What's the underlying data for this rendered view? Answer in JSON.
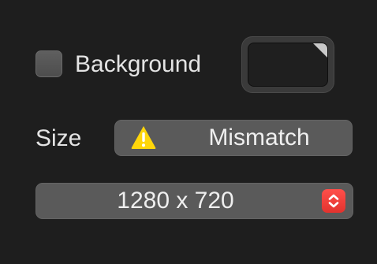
{
  "background": {
    "label": "Background",
    "checked": false,
    "color_well_color": "#1f1f1f"
  },
  "size": {
    "label": "Size",
    "mismatch_label": "Mismatch",
    "warning_icon": "warning-triangle-icon",
    "warning_color": "#ffd60a"
  },
  "resolution": {
    "selected": "1280 x 720",
    "stepper_icon": "chevron-up-down-icon",
    "accent": "#ff453a"
  },
  "theme": {
    "panel_bg": "#1e1e1e",
    "control_bg": "#5a5a5a",
    "text": "#e6e6e6"
  }
}
